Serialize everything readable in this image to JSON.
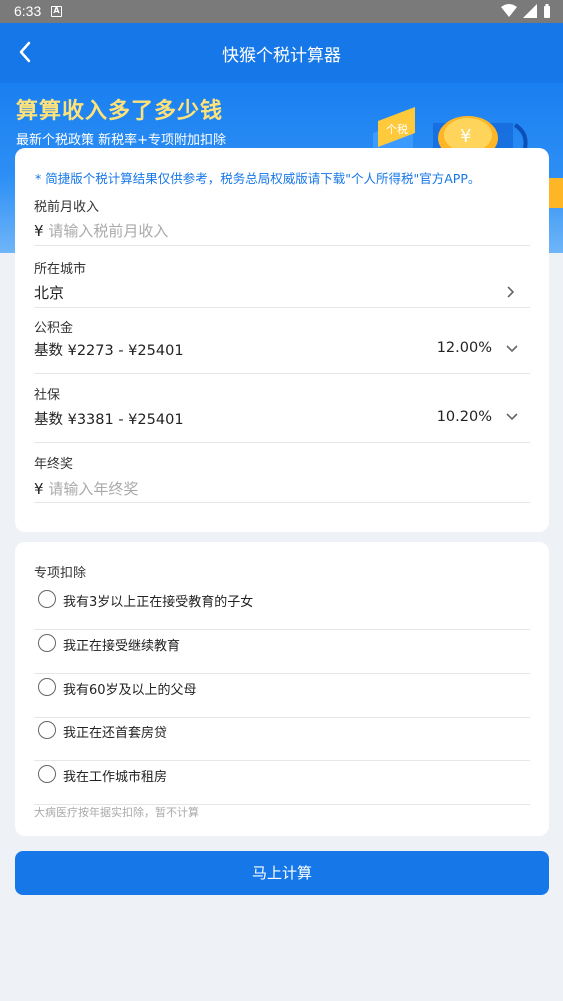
{
  "status_bar": {
    "time": "6:33",
    "app_icon_letter": "A"
  },
  "app_bar": {
    "title": "快猴个税计算器"
  },
  "banner": {
    "headline": "算算收入多了多少钱",
    "subline": "最新个税政策 新税率+专项附加扣除",
    "tag_text": "个税",
    "coin_symbol": "¥"
  },
  "form": {
    "notice": "* 简捷版个税计算结果仅供参考，税务总局权威版请下载\"个人所得税\"官方APP。",
    "income": {
      "label": "税前月收入",
      "currency": "¥",
      "placeholder": "请输入税前月收入"
    },
    "city": {
      "label": "所在城市",
      "value": "北京"
    },
    "housing_fund": {
      "label": "公积金",
      "base": "基数 ¥2273 - ¥25401",
      "rate": "12.00%"
    },
    "social_security": {
      "label": "社保",
      "base": "基数 ¥3381 - ¥25401",
      "rate": "10.20%"
    },
    "bonus": {
      "label": "年终奖",
      "currency": "¥",
      "placeholder": "请输入年终奖"
    }
  },
  "deductions": {
    "title": "专项扣除",
    "options": [
      {
        "label": "我有3岁以上正在接受教育的子女"
      },
      {
        "label": "我正在接受继续教育"
      },
      {
        "label": "我有60岁及以上的父母"
      },
      {
        "label": "我正在还首套房贷"
      },
      {
        "label": "我在工作城市租房"
      }
    ],
    "footnote": "大病医疗按年据实扣除，暂不计算"
  },
  "actions": {
    "calculate_label": "马上计算"
  },
  "colors": {
    "primary": "#1677e8",
    "headline": "#ffe27a",
    "notice": "#1677e8"
  }
}
